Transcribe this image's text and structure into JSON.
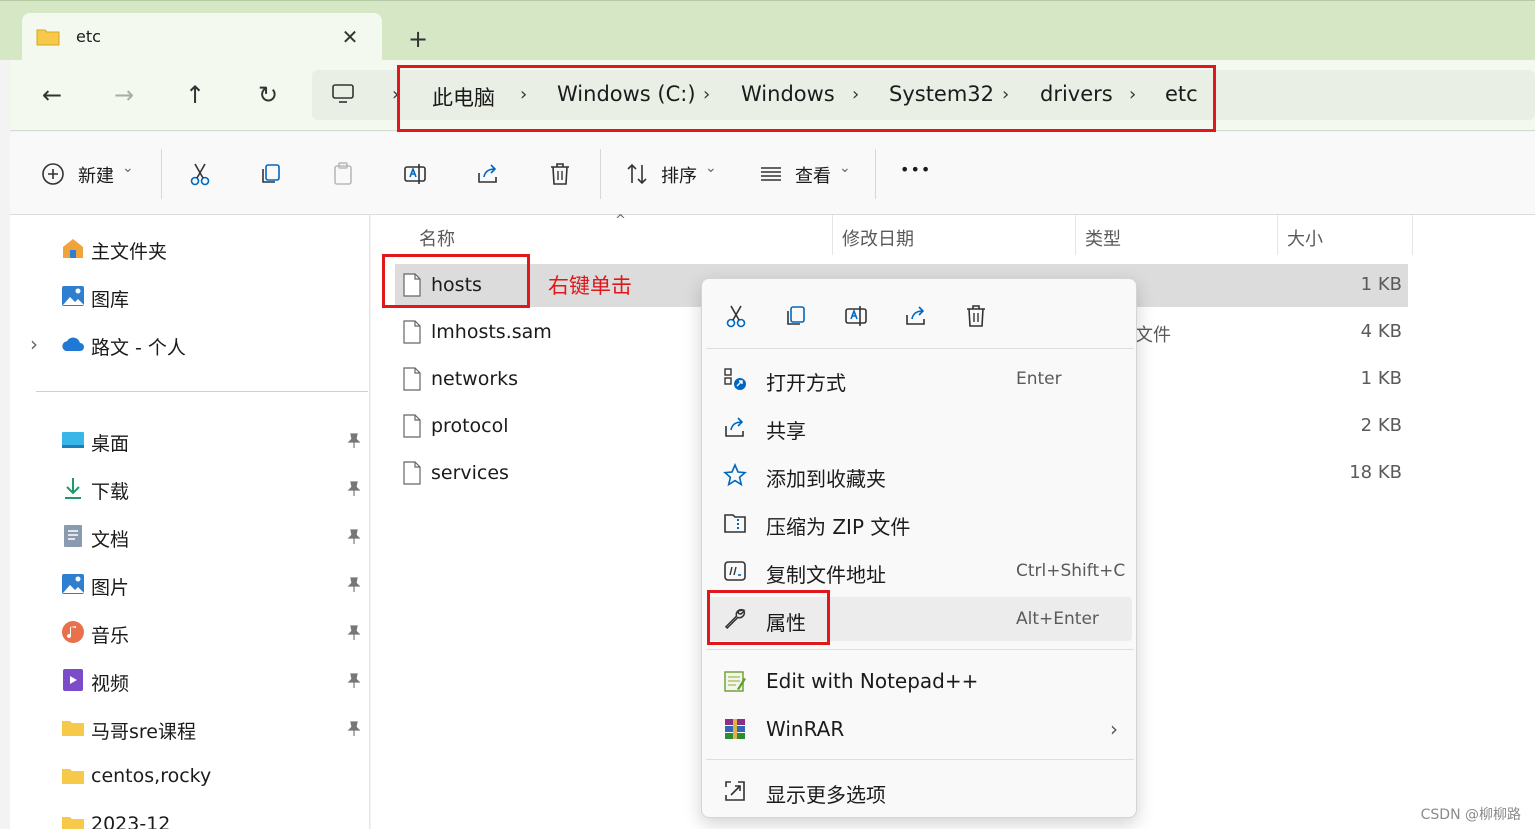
{
  "tab": {
    "label": "etc",
    "close": "✕",
    "new_tab": "+"
  },
  "nav": {
    "back": "←",
    "forward": "→",
    "up": "↑",
    "refresh": "↻",
    "sep": "›"
  },
  "breadcrumb": [
    "此电脑",
    "Windows (C:)",
    "Windows",
    "System32",
    "drivers",
    "etc"
  ],
  "toolbar": {
    "new_label": "新建",
    "sort_label": "排序",
    "view_label": "查看",
    "more": "•••",
    "chevron": "⌄"
  },
  "sidebar": {
    "top_items": [
      {
        "label": "主文件夹",
        "icon": "home-icon"
      },
      {
        "label": "图库",
        "icon": "gallery-icon"
      },
      {
        "label": "路文 - 个人",
        "icon": "onedrive-icon",
        "expand": "›"
      }
    ],
    "pinned": [
      {
        "label": "桌面",
        "icon": "desktop-icon"
      },
      {
        "label": "下载",
        "icon": "download-icon"
      },
      {
        "label": "文档",
        "icon": "documents-icon"
      },
      {
        "label": "图片",
        "icon": "pictures-icon"
      },
      {
        "label": "音乐",
        "icon": "music-icon"
      },
      {
        "label": "视频",
        "icon": "videos-icon"
      },
      {
        "label": "马哥sre课程",
        "icon": "folder-icon"
      },
      {
        "label": "centos,rocky",
        "icon": "folder-icon"
      },
      {
        "label": "2023-12",
        "icon": "folder-icon"
      }
    ]
  },
  "columns": {
    "name": "名称",
    "modified": "修改日期",
    "type": "类型",
    "size": "大小"
  },
  "files": [
    {
      "name": "hosts",
      "size": "1 KB",
      "type": ""
    },
    {
      "name": "lmhosts.sam",
      "size": "4 KB",
      "type": "文件"
    },
    {
      "name": "networks",
      "size": "1 KB",
      "type": ""
    },
    {
      "name": "protocol",
      "size": "2 KB",
      "type": ""
    },
    {
      "name": "services",
      "size": "18 KB",
      "type": ""
    }
  ],
  "annotation": "右键单击",
  "context_menu": {
    "items": [
      {
        "label": "打开方式",
        "shortcut": "Enter"
      },
      {
        "label": "共享",
        "shortcut": ""
      },
      {
        "label": "添加到收藏夹",
        "shortcut": ""
      },
      {
        "label": "压缩为 ZIP 文件",
        "shortcut": ""
      },
      {
        "label": "复制文件地址",
        "shortcut": "Ctrl+Shift+C"
      },
      {
        "label": "属性",
        "shortcut": "Alt+Enter"
      }
    ],
    "ext_items": [
      {
        "label": "Edit with Notepad++"
      },
      {
        "label": "WinRAR",
        "arrow": "›"
      }
    ],
    "more": {
      "label": "显示更多选项"
    }
  },
  "watermark": "CSDN @柳柳路",
  "colors": {
    "accent": "#0067c0",
    "highlight": "#e0181b",
    "titlebar": "#d6e7c6"
  }
}
